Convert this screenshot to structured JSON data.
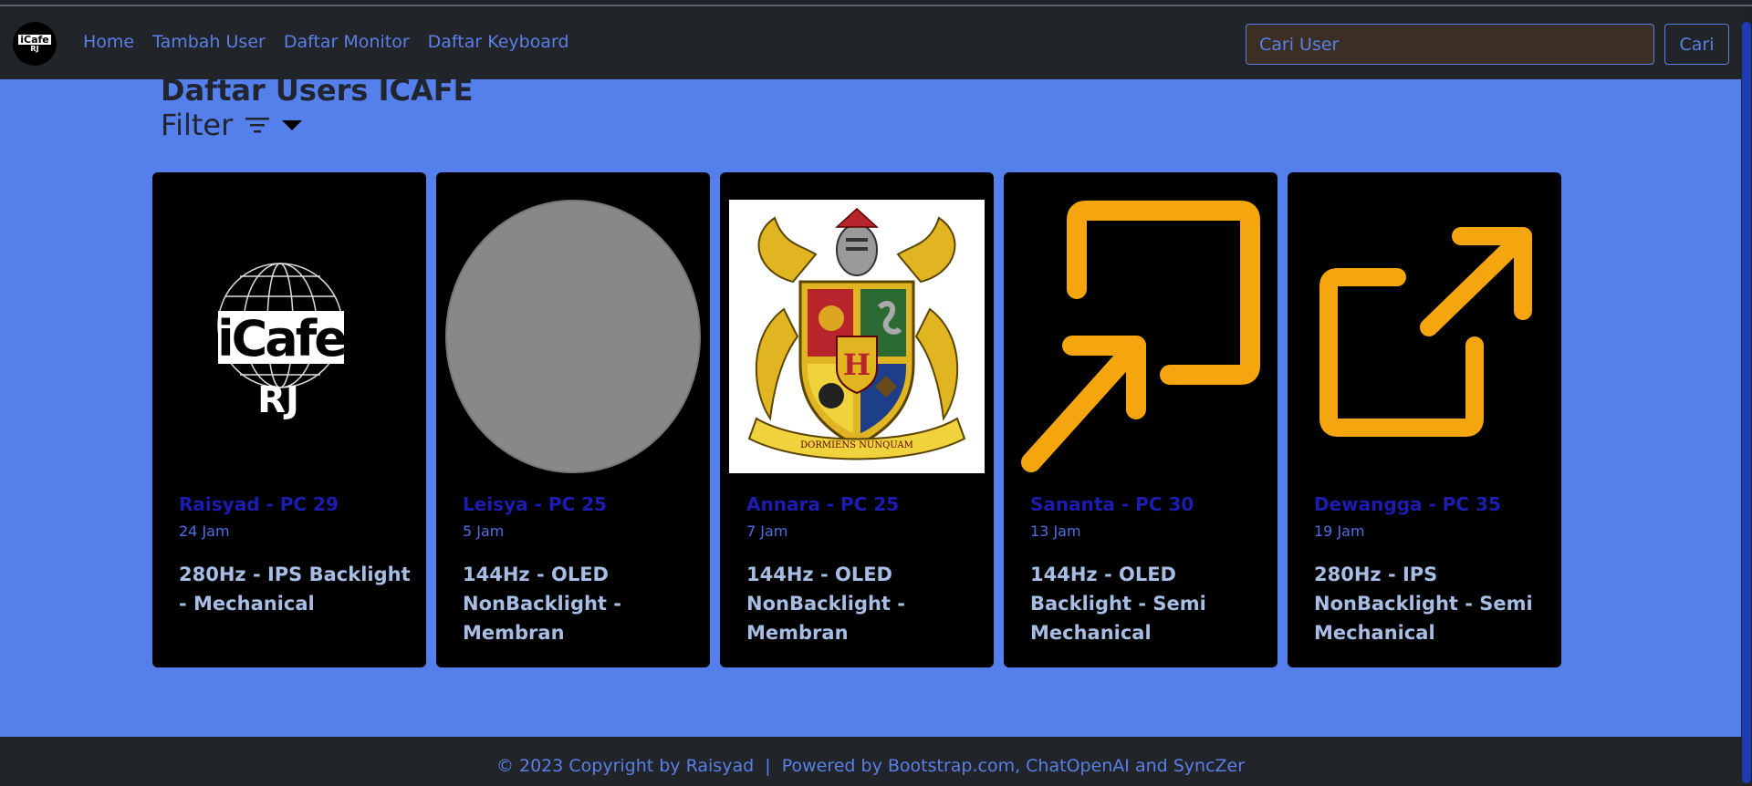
{
  "brand": {
    "line1": "iCafe",
    "line2": "RJ"
  },
  "nav": {
    "home": "Home",
    "add_user": "Tambah User",
    "monitor_list": "Daftar Monitor",
    "keyboard_list": "Daftar Keyboard"
  },
  "search": {
    "placeholder": "Cari User",
    "button": "Cari"
  },
  "page": {
    "title": "Daftar Users ICAFE",
    "filter_label": "Filter"
  },
  "cards": [
    {
      "name": "Raisyad - PC 29",
      "hours": "24 Jam",
      "spec": "280Hz - IPS Backlight - Mechanical",
      "image": "icafe-rj-logo",
      "logo_text": "iCafe",
      "logo_sub": "RJ"
    },
    {
      "name": "Leisya - PC 25",
      "hours": "5 Jam",
      "spec": "144Hz - OLED NonBacklight - Membran",
      "image": "gray-circle"
    },
    {
      "name": "Annara - PC 25",
      "hours": "7 Jam",
      "spec": "144Hz - OLED NonBacklight - Membran",
      "image": "hogwarts-crest"
    },
    {
      "name": "Sananta - PC 30",
      "hours": "13 Jam",
      "spec": "144Hz - OLED Backlight - Semi Mechanical",
      "image": "minimize-arrow-icon"
    },
    {
      "name": "Dewangga - PC 35",
      "hours": "19 Jam",
      "spec": "280Hz - IPS NonBacklight - Semi Mechanical",
      "image": "external-link-icon"
    }
  ],
  "footer": {
    "text": "© 2023 Copyright by Raisyad  |  Powered by Bootstrap.com, ChatOpenAI and SyncZer"
  },
  "colors": {
    "background": "#5580eb",
    "navbar": "#212429",
    "link": "#5b7fe6",
    "card_name": "#1c1cb0",
    "icon_orange": "#f5a60f"
  }
}
